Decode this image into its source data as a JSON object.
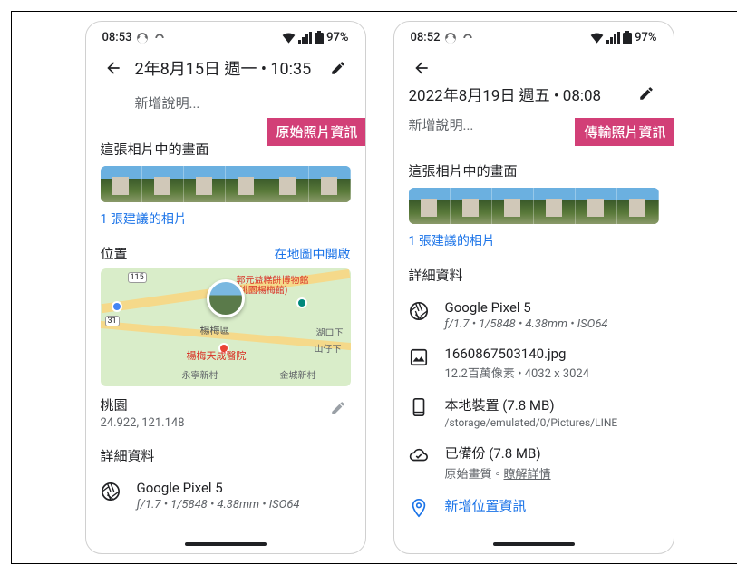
{
  "left": {
    "status": {
      "time": "08:53",
      "battery": "97%"
    },
    "date": "2年8月15日 週一 • 10:35",
    "placeholder": "新增說明...",
    "badge": "原始照片資訊",
    "strip_title": "這張相片中的畫面",
    "strip_link": "1 張建議的相片",
    "location": {
      "title": "位置",
      "open_in_map": "在地圖中開啟",
      "poi1": "郭元益糕餅博物館\n(桃園楊梅館)",
      "poi2": "楊梅區",
      "poi3": "楊梅天成醫院",
      "poi4": "湖口下",
      "poi5": "山仔下",
      "poi6": "永寧新村",
      "poi7": "金城新村",
      "place": "桃園",
      "coords": "24.922, 121.148"
    },
    "details_title": "詳細資料",
    "device": {
      "name": "Google Pixel 5",
      "meta": "ƒ/1.7  •  1/5848  •  4.38mm  •  ISO64"
    }
  },
  "right": {
    "status": {
      "time": "08:52",
      "battery": "97%"
    },
    "date": "2022年8月19日 週五 • 08:08",
    "placeholder": "新增說明...",
    "badge": "傳輸照片資訊",
    "strip_title": "這張相片中的畫面",
    "strip_link": "1 張建議的相片",
    "details_title": "詳細資料",
    "device": {
      "name": "Google Pixel 5",
      "meta": "ƒ/1.7  •  1/5848  •  4.38mm  •  ISO64"
    },
    "file": {
      "name": "1660867503140.jpg",
      "meta": "12.2百萬像素  •  4032 x 3024"
    },
    "storage": {
      "name": "本地裝置 (7.8 MB)",
      "path": "/storage/emulated/0/Pictures/LINE"
    },
    "backup": {
      "name": "已備份 (7.8 MB)",
      "meta_prefix": "原始畫質。",
      "meta_link": "瞭解詳情"
    },
    "add_location": "新增位置資訊"
  }
}
